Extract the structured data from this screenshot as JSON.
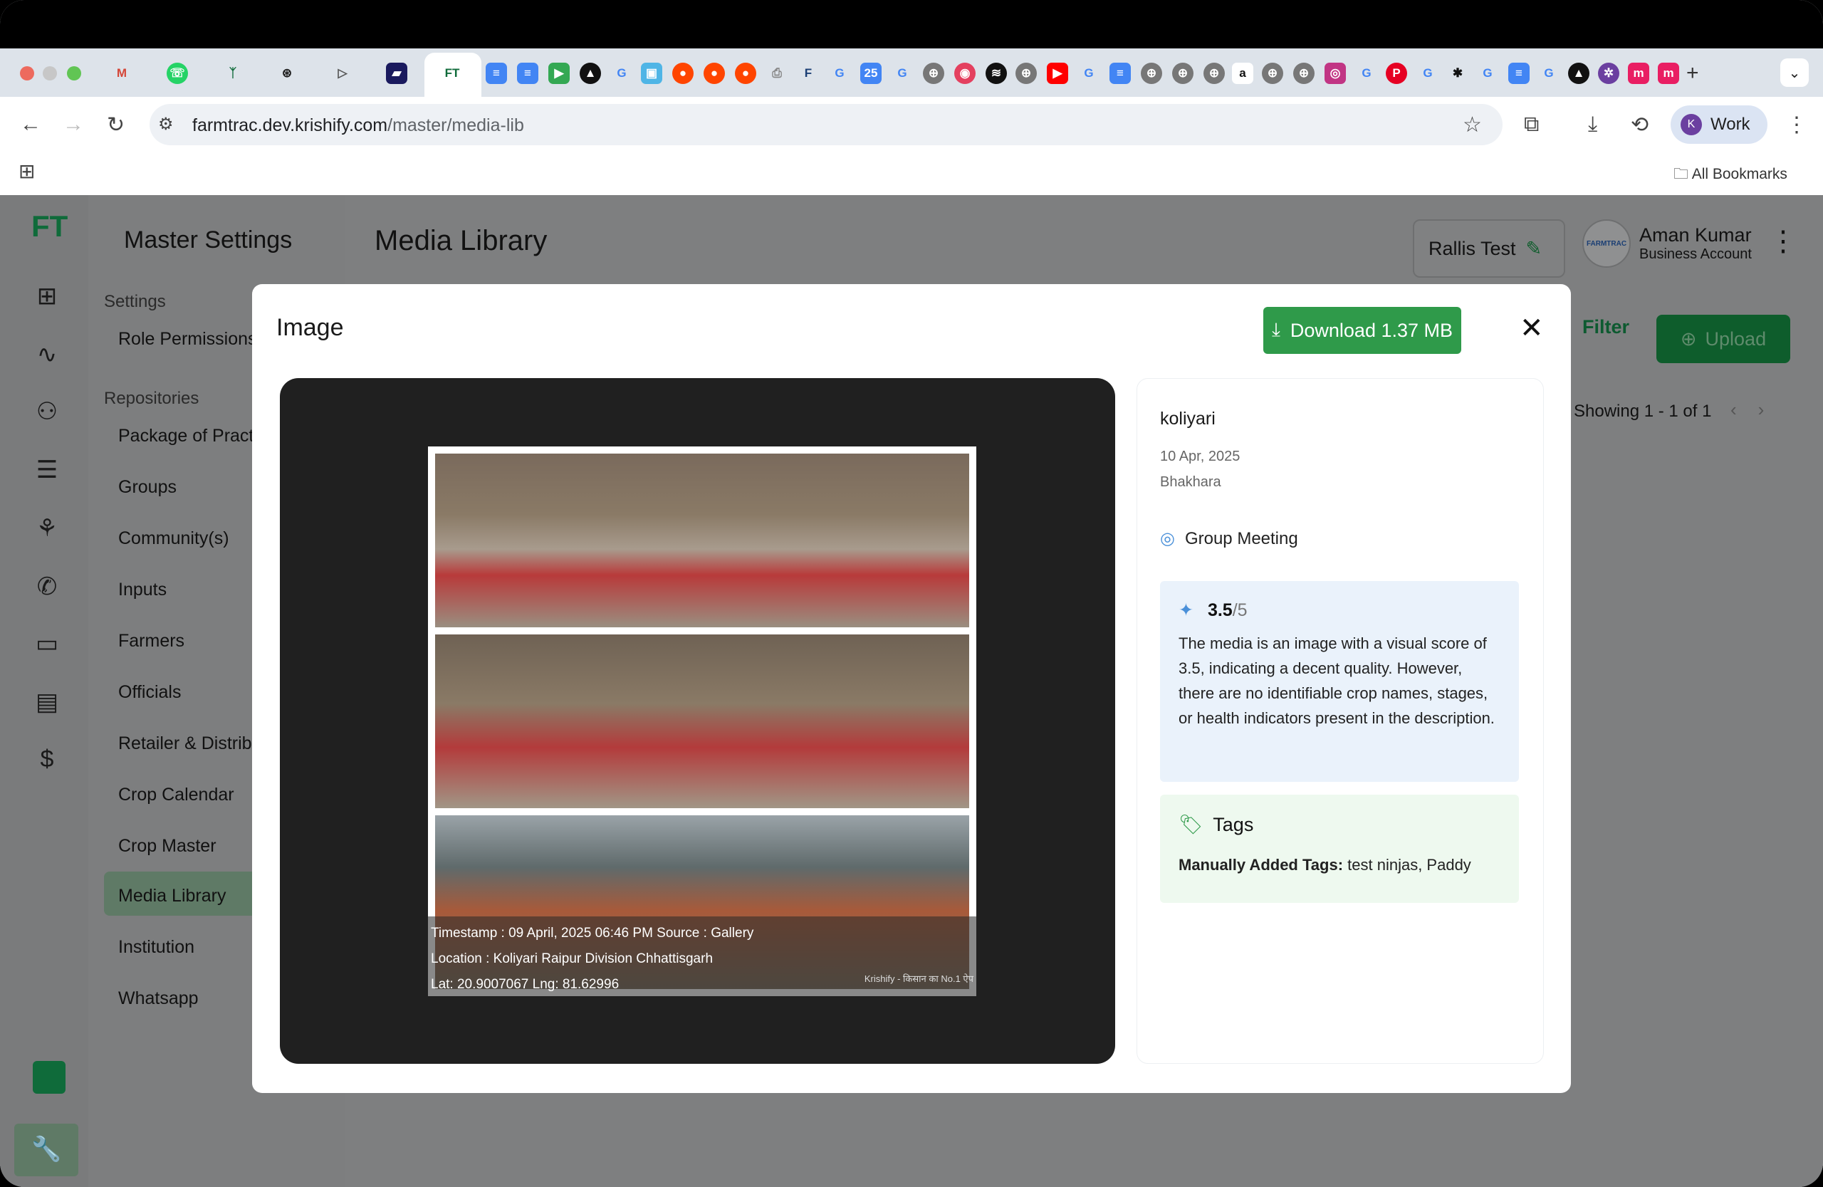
{
  "browser": {
    "url_host": "farmtrac.dev.krishify.com",
    "url_path": "/master/media-lib",
    "active_tab_label": "FT",
    "profile_label": "Work",
    "profile_initial": "K",
    "bookmarks_label": "All Bookmarks"
  },
  "app": {
    "logo": "FT",
    "sidenav_title": "Master Settings",
    "sections": {
      "settings": "Settings",
      "repositories": "Repositories"
    },
    "nav_items": [
      "Role Permissions",
      "Package of Practices",
      "Groups",
      "Community(s)",
      "Inputs",
      "Farmers",
      "Officials",
      "Retailer & Distributors",
      "Crop Calendar",
      "Crop Master",
      "Media Library",
      "Institution",
      "Whatsapp"
    ],
    "page_title": "Media Library",
    "workspace_button": "Rallis Test",
    "user_name": "Aman Kumar",
    "user_role": "Business Account",
    "avatar_text": "FARMTRAC",
    "filter_label": "Filter",
    "upload_label": "Upload",
    "showing": "Showing 1 - 1 of 1"
  },
  "modal": {
    "title": "Image",
    "download_label": "Download 1.37 MB",
    "photo_overlay": {
      "line1": "Timestamp : 09 April, 2025 06:46 PM   Source : Gallery",
      "line2": "Location : Koliyari Raipur Division Chhattisgarh",
      "line3": "Lat: 20.9007067  Lng: 81.62996",
      "watermark": "Krishify - किसान का No.1 ऐप"
    },
    "info": {
      "name": "koliyari",
      "date": "10 Apr, 2025",
      "place": "Bhakhara",
      "category": "Group Meeting",
      "score": "3.5",
      "score_max": "/5",
      "description": "The media is an image with a visual score of 3.5, indicating a decent quality. However, there are no identifiable crop names, stages, or health indicators present in the description.",
      "tags_title": "Tags",
      "tags_label": "Manually Added Tags:",
      "tags_value": " test ninjas, Paddy"
    }
  },
  "colors": {
    "primary_green": "#2f9a4a",
    "score_bg": "#eaf2fb",
    "tags_bg": "#eef9ef"
  }
}
